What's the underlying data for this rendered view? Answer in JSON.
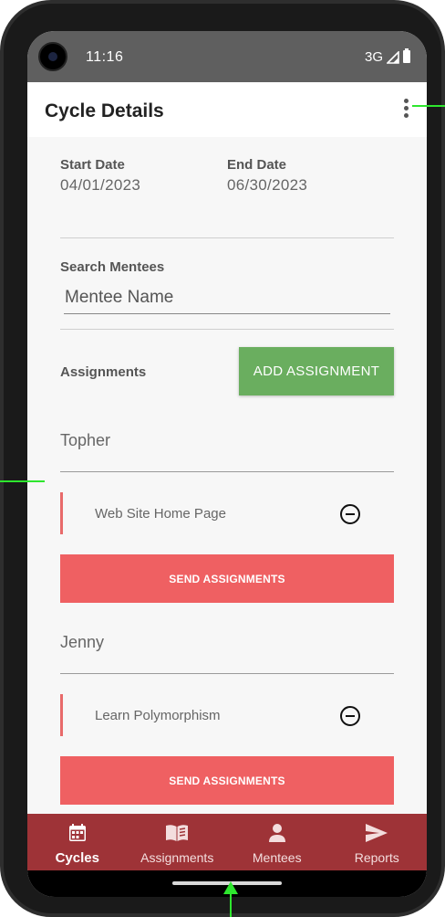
{
  "status_bar": {
    "time": "11:16",
    "network": "3G"
  },
  "app_bar": {
    "title": "Cycle Details"
  },
  "cycle": {
    "start_label": "Start Date",
    "start_value": "04/01/2023",
    "end_label": "End Date",
    "end_value": "06/30/2023"
  },
  "search": {
    "label": "Search Mentees",
    "placeholder": "Mentee Name"
  },
  "assignments": {
    "label": "Assignments",
    "add_label": "ADD ASSIGNMENT"
  },
  "mentees": [
    {
      "name": "Topher",
      "assignment": "Web Site Home Page",
      "send_label": "SEND ASSIGNMENTS"
    },
    {
      "name": "Jenny",
      "assignment": "Learn Polymorphism",
      "send_label": "SEND ASSIGNMENTS"
    }
  ],
  "nav": {
    "items": [
      {
        "label": "Cycles",
        "icon": "calendar-icon",
        "active": true
      },
      {
        "label": "Assignments",
        "icon": "book-icon"
      },
      {
        "label": "Mentees",
        "icon": "person-icon"
      },
      {
        "label": "Reports",
        "icon": "send-icon"
      }
    ]
  },
  "colors": {
    "accent_green": "#6aae5f",
    "send_red": "#ef6062",
    "nav_bar": "#9e3337",
    "annotation": "#2ee62e"
  }
}
